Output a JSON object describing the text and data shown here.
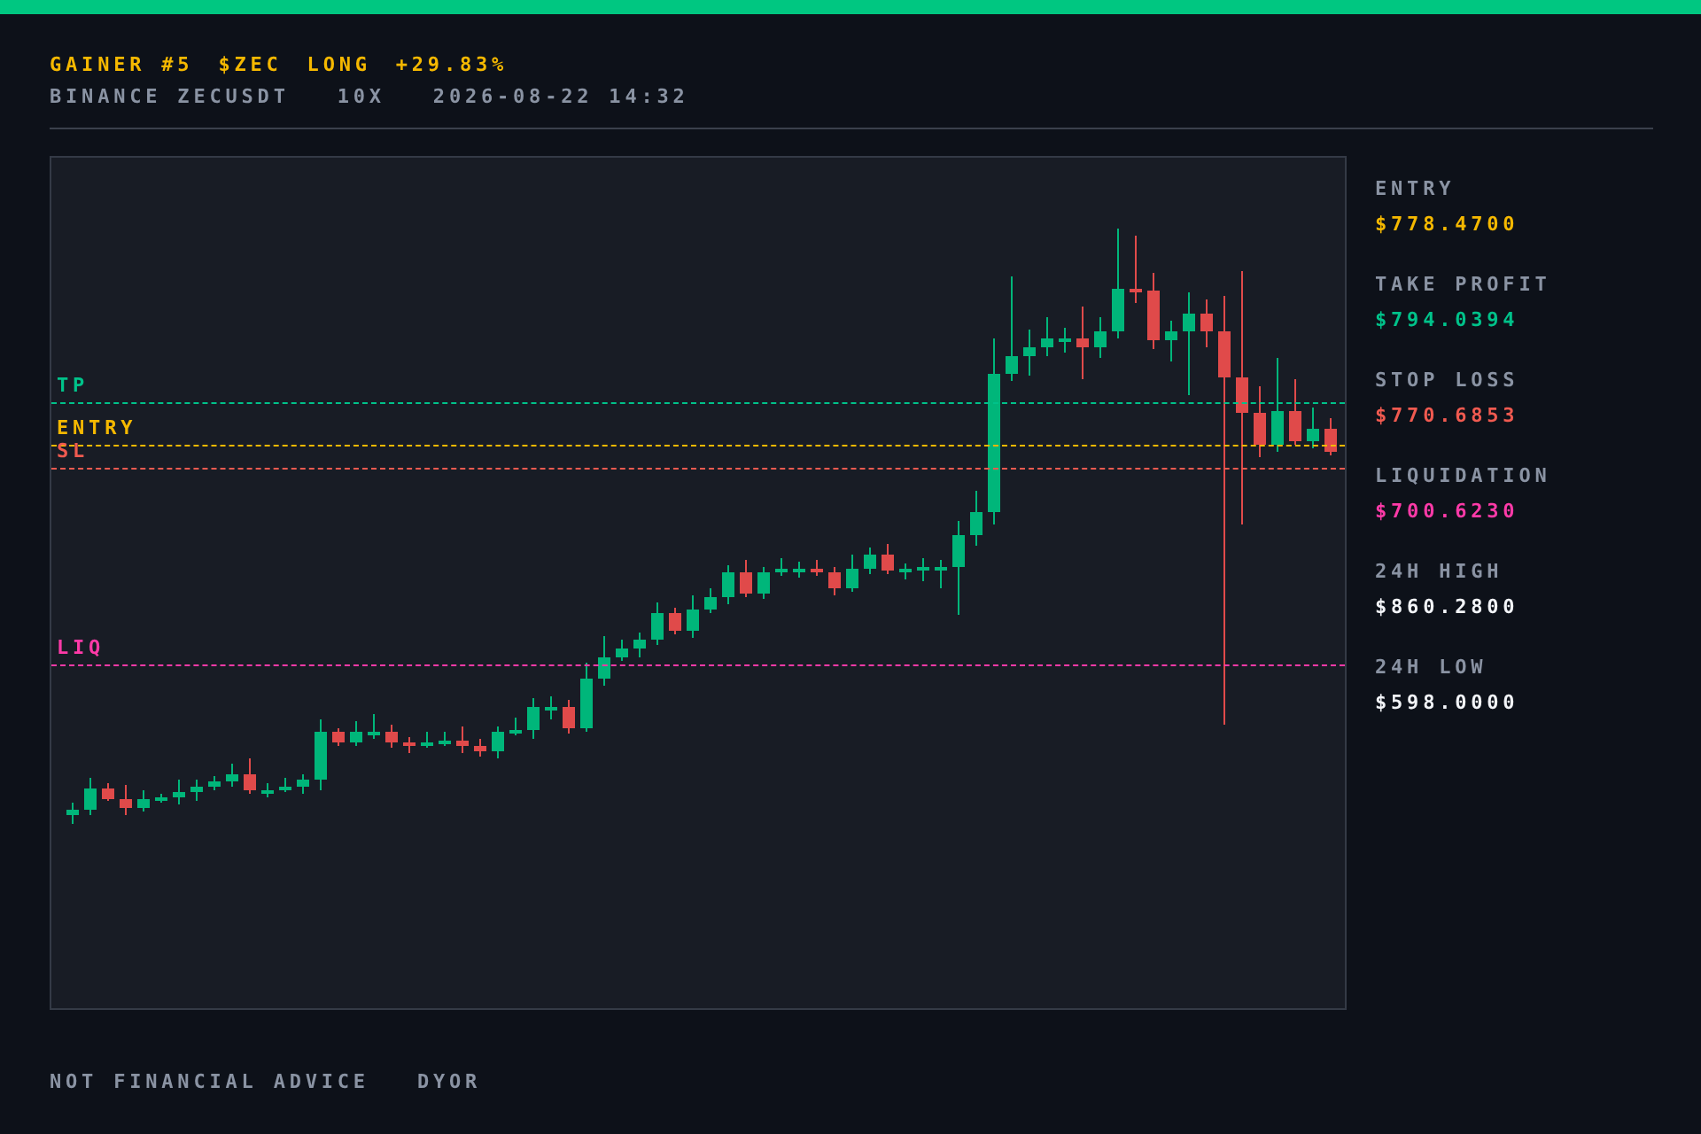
{
  "header": {
    "title_parts": [
      {
        "text": "GAINER #5"
      },
      {
        "text": "$ZEC"
      },
      {
        "text": "LONG"
      },
      {
        "text": "+29.83%"
      }
    ],
    "subtitle_parts": [
      {
        "text": "BINANCE ZECUSDT"
      },
      {
        "text": "10X"
      },
      {
        "text": "2026-08-22 14:32"
      }
    ]
  },
  "chart": {
    "levels": [
      {
        "label": "TP",
        "color": "#00c28a"
      },
      {
        "label": "ENTRY",
        "color": "#f5b800"
      },
      {
        "label": "SL",
        "color": "#f05a50"
      },
      {
        "label": "LIQ",
        "color": "#ff3aa8"
      }
    ]
  },
  "stats": [
    {
      "label": "ENTRY",
      "value": "$778.4700",
      "color": "#f5b800"
    },
    {
      "label": "TAKE PROFIT",
      "value": "$794.0394",
      "color": "#00c28a"
    },
    {
      "label": "STOP LOSS",
      "value": "$770.6853",
      "color": "#f05a50"
    },
    {
      "label": "LIQUIDATION",
      "value": "$700.6230",
      "color": "#ff3aa8"
    },
    {
      "label": "24H HIGH",
      "value": "$860.2800",
      "color": "#f2f4f8"
    },
    {
      "label": "24H LOW",
      "value": "$598.0000",
      "color": "#f2f4f8"
    }
  ],
  "footer": {
    "parts": [
      {
        "text": "NOT FINANCIAL ADVICE"
      },
      {
        "text": "DYOR"
      }
    ]
  }
}
